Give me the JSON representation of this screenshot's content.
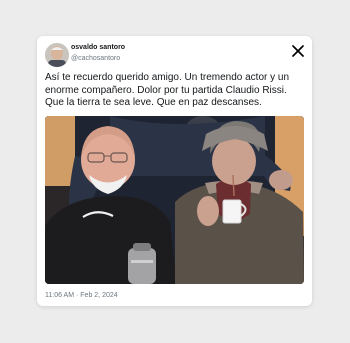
{
  "tweet": {
    "author_name": "osvaldo santoro",
    "author_handle": "@cachosantoro",
    "text": "Así te recuerdo querido amigo. Un tremendo actor y un enorme compañero. Dolor por tu partida Claudio Rissi. Que la tierra te sea leve. Que en paz descanses.",
    "timestamp": "11:06 AM · Feb 2, 2024",
    "icons": {
      "platform": "x-logo-icon"
    }
  }
}
